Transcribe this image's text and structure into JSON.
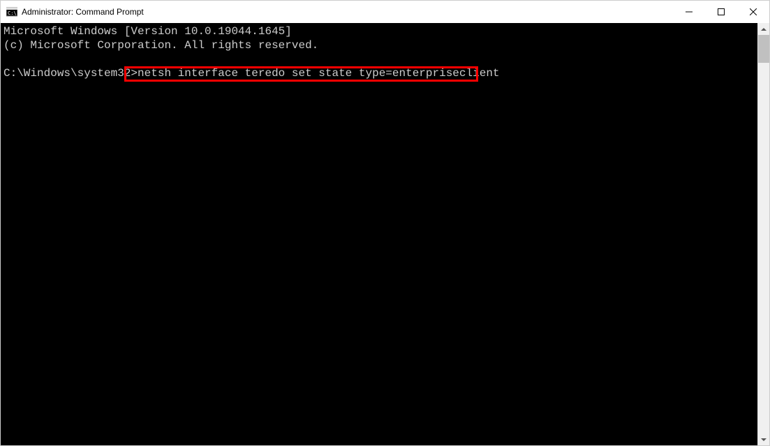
{
  "window": {
    "title": "Administrator: Command Prompt"
  },
  "terminal": {
    "line1": "Microsoft Windows [Version 10.0.19044.1645]",
    "line2": "(c) Microsoft Corporation. All rights reserved.",
    "prompt": "C:\\Windows\\system32>",
    "command": "netsh interface teredo set state type=enterpriseclient"
  },
  "highlight": {
    "color": "#ff0000"
  }
}
